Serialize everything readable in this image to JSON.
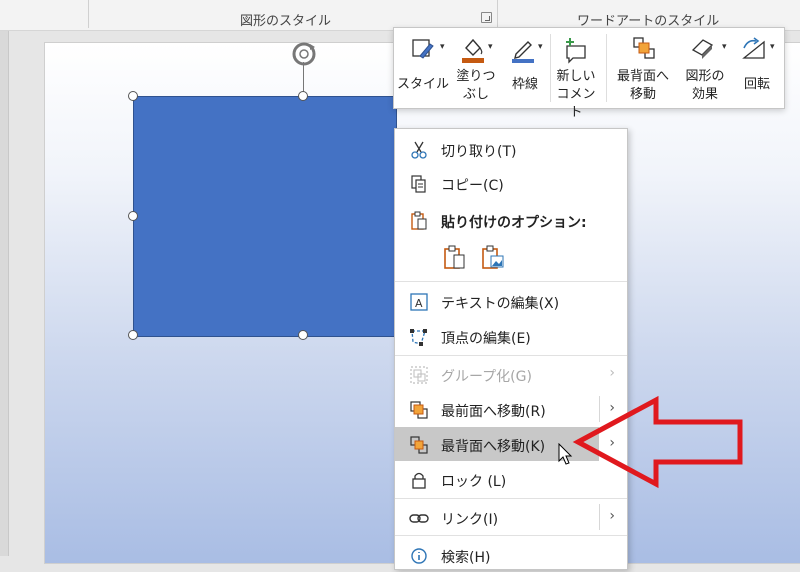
{
  "ribbon": {
    "groups": [
      {
        "label": "図形のスタイル"
      },
      {
        "label": "ワードアートのスタイル"
      }
    ]
  },
  "mini_toolbar": {
    "buttons": [
      {
        "label_lines": [
          "スタイル"
        ],
        "icon": "style-brush-icon",
        "has_dropdown": true
      },
      {
        "label_lines": [
          "塗りつ",
          "ぶし"
        ],
        "icon": "paint-bucket-icon",
        "has_dropdown": true,
        "color": "#c55a11"
      },
      {
        "label_lines": [
          "枠線"
        ],
        "icon": "pen-outline-icon",
        "has_dropdown": true,
        "color": "#4472c4"
      },
      {
        "label_lines": [
          "新しい",
          "コメント"
        ],
        "icon": "new-comment-icon",
        "has_dropdown": false
      },
      {
        "label_lines": [
          "最背面へ",
          "移動"
        ],
        "icon": "send-to-back-icon",
        "has_dropdown": false
      },
      {
        "label_lines": [
          "図形の",
          "効果"
        ],
        "icon": "shape-effects-icon",
        "has_dropdown": true
      },
      {
        "label_lines": [
          "回転"
        ],
        "icon": "rotate-icon",
        "has_dropdown": true
      }
    ]
  },
  "context_menu": {
    "items": [
      {
        "text": "切り取り(T)",
        "icon": "scissors-icon"
      },
      {
        "text": "コピー(C)",
        "icon": "copy-icon"
      },
      {
        "text": "貼り付けのオプション:",
        "icon": "paste-icon",
        "bold": true
      },
      {
        "text": "テキストの編集(X)",
        "icon": "edit-text-icon"
      },
      {
        "text": "頂点の編集(E)",
        "icon": "edit-points-icon"
      },
      {
        "text": "グループ化(G)",
        "icon": "group-icon",
        "disabled": true,
        "submenu": true
      },
      {
        "text": "最前面へ移動(R)",
        "icon": "bring-to-front-icon",
        "submenu": true
      },
      {
        "text": "最背面へ移動(K)",
        "icon": "send-to-back-icon",
        "submenu": true,
        "highlighted": true
      },
      {
        "text": "ロック (L)",
        "icon": "lock-icon"
      },
      {
        "text": "リンク(I)",
        "icon": "link-icon",
        "submenu": true
      },
      {
        "text": "検索(H)",
        "icon": "search-info-icon"
      }
    ],
    "paste_options": [
      {
        "icon": "paste-keep-source-icon"
      },
      {
        "icon": "paste-picture-icon"
      }
    ]
  },
  "colors": {
    "shape_fill": "#4472c4",
    "accent_orange": "#c55a11",
    "annotation_arrow": "#e0191e",
    "hover": "#c8c8c8"
  }
}
